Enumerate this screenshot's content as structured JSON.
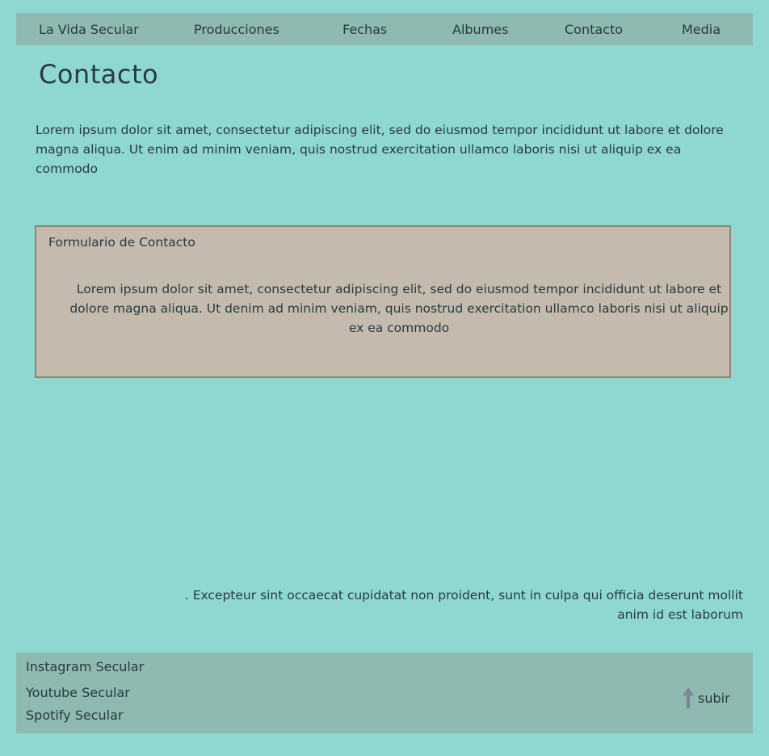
{
  "nav": {
    "items": [
      "La Vida Secular",
      "Producciones",
      "Fechas",
      "Albumes",
      "Contacto",
      "Media"
    ]
  },
  "page_title": "Contacto",
  "intro_text": "Lorem ipsum dolor sit amet, consectetur adipiscing elit, sed do eiusmod tempor incididunt ut labore et dolore magna aliqua. Ut enim ad minim veniam, quis nostrud exercitation ullamco laboris nisi ut aliquip ex ea commodo",
  "contact_form": {
    "title": "Formulario de Contacto",
    "text": "Lorem ipsum dolor sit amet, consectetur adipiscing elit, sed do eiusmod tempor incididunt ut labore et dolore magna aliqua. Ut denim ad minim veniam, quis nostrud exercitation ullamco laboris nisi ut aliquip ex ea commodo"
  },
  "excerpt_text": ". Excepteur sint occaecat cupidatat non proident, sunt in culpa qui officia deserunt mollit anim id est laborum",
  "footer": {
    "links": [
      "Instagram Secular",
      "Youtube Secular",
      "Spotify Secular"
    ],
    "back_to_top": {
      "label": "subir",
      "icon": "arrow-up-icon"
    }
  },
  "colors": {
    "background": "#8ed8cf",
    "bars": "#8fbab1",
    "form_bg": "#c4bbae",
    "form_border": "#8e8370",
    "text": "#273b40",
    "arrow": "#7d8597"
  }
}
